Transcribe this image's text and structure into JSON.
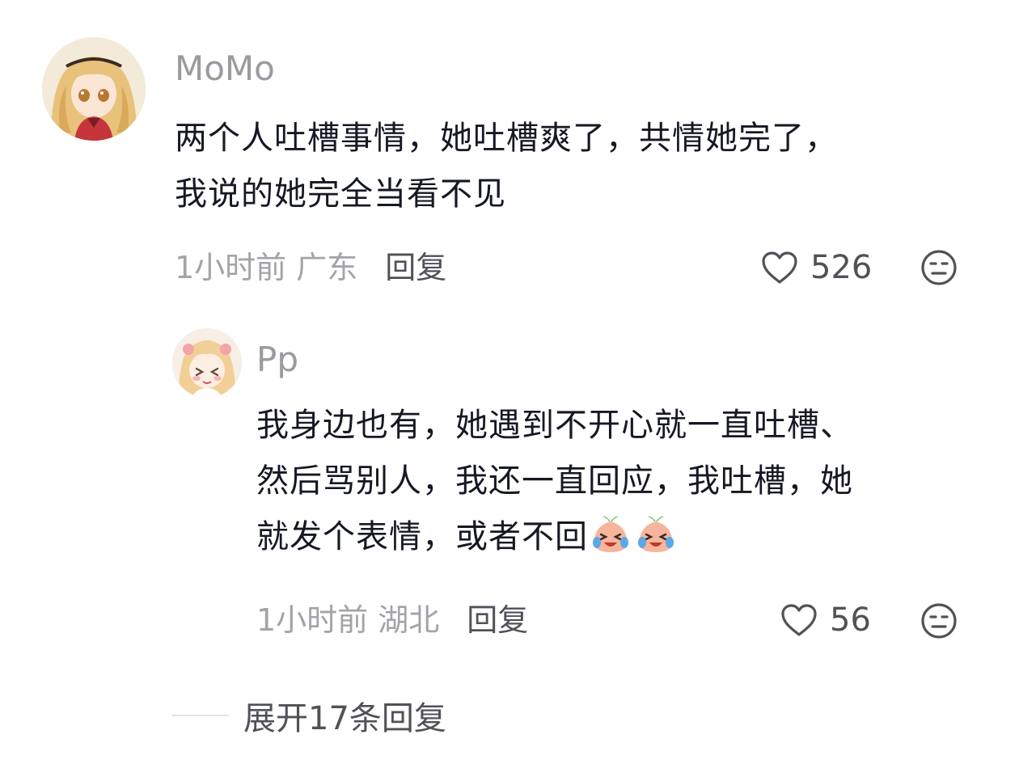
{
  "comment": {
    "username": "MoMo",
    "text_line1": "两个人吐槽事情，她吐槽爽了，共情她完了，",
    "text_line2": "我说的她完全当看不见",
    "time": "1小时前",
    "region": "广东",
    "reply_label": "回复",
    "like_count": "526"
  },
  "reply": {
    "username": "Pp",
    "text_line1": "我身边也有，她遇到不开心就一直吐槽、",
    "text_line2": "然后骂别人，我还一直回应，我吐槽，她",
    "text_line3": "就发个表情，或者不回",
    "emoji": "crying-laughing-face-icon",
    "time": "1小时前",
    "region": "湖北",
    "reply_label": "回复",
    "like_count": "56"
  },
  "expand_replies_label": "展开17条回复",
  "colors": {
    "username": "#9a9a9f",
    "text": "#161823",
    "meta": "#a3a3a8",
    "action": "#505258"
  }
}
